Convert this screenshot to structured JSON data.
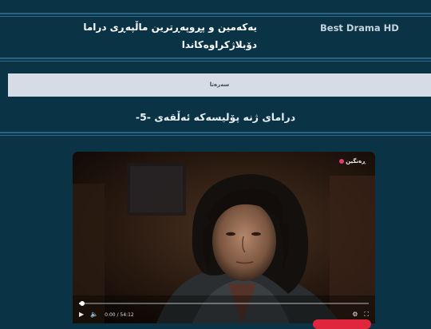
{
  "header": {
    "brand": "Best Drama HD",
    "tagline": "یەکەمین و پڕوپەڕترین ماڵپەڕی دراما دۆبلاژکراوەکاندا"
  },
  "nav": {
    "home_label": "سەرەتا"
  },
  "page": {
    "title": "درامای ژنە پۆلیسەکە ئەڵقەی -5-"
  },
  "player": {
    "watermark": "ڕەنگین",
    "progress": 0.01,
    "time": "0:00 / 54:12"
  },
  "colors": {
    "background": "#0b3346",
    "rule": "#2f6c91",
    "navbar": "#d6dce6",
    "accent_button": "#e0263c"
  },
  "icons": [
    "play-icon",
    "volume-icon",
    "settings-icon",
    "fullscreen-icon",
    "logo-dot-icon"
  ]
}
